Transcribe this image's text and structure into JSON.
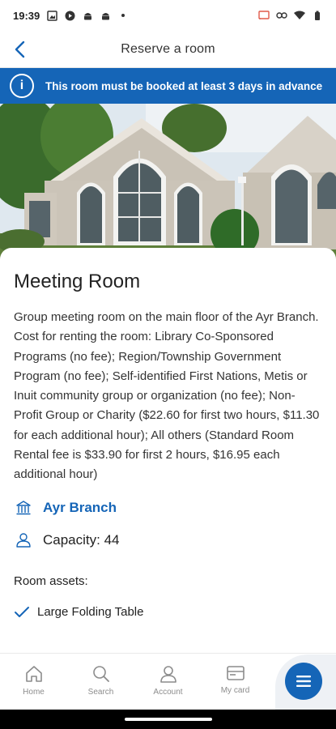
{
  "status_bar": {
    "time": "19:39"
  },
  "header": {
    "title": "Reserve a room"
  },
  "banner": {
    "message": "This room must be booked at least 3 days in advance"
  },
  "room": {
    "name": "Meeting Room",
    "description": "Group meeting room on the main floor of the Ayr Branch. Cost for renting the room: Library Co-Sponsored Programs (no fee); Region/Township Government Program (no fee); Self-identified First Nations, Metis or Inuit community group or organization (no fee); Non-Profit Group or Charity ($22.60 for first two hours, $11.30 for each additional hour); All others (Standard Room Rental fee is $33.90 for first 2 hours, $16.95 each additional hour)",
    "branch": "Ayr Branch",
    "capacity": "Capacity: 44",
    "assets_label": "Room assets:",
    "assets": [
      "Large Folding Table"
    ]
  },
  "nav": {
    "items": [
      {
        "label": "Home",
        "icon": "home-icon"
      },
      {
        "label": "Search",
        "icon": "search-icon"
      },
      {
        "label": "Account",
        "icon": "account-icon"
      },
      {
        "label": "My card",
        "icon": "card-icon"
      }
    ],
    "menu_icon": "menu-icon"
  },
  "colors": {
    "brand": "#1565b7",
    "text": "#222222",
    "nav_label": "#8c8c8c"
  }
}
